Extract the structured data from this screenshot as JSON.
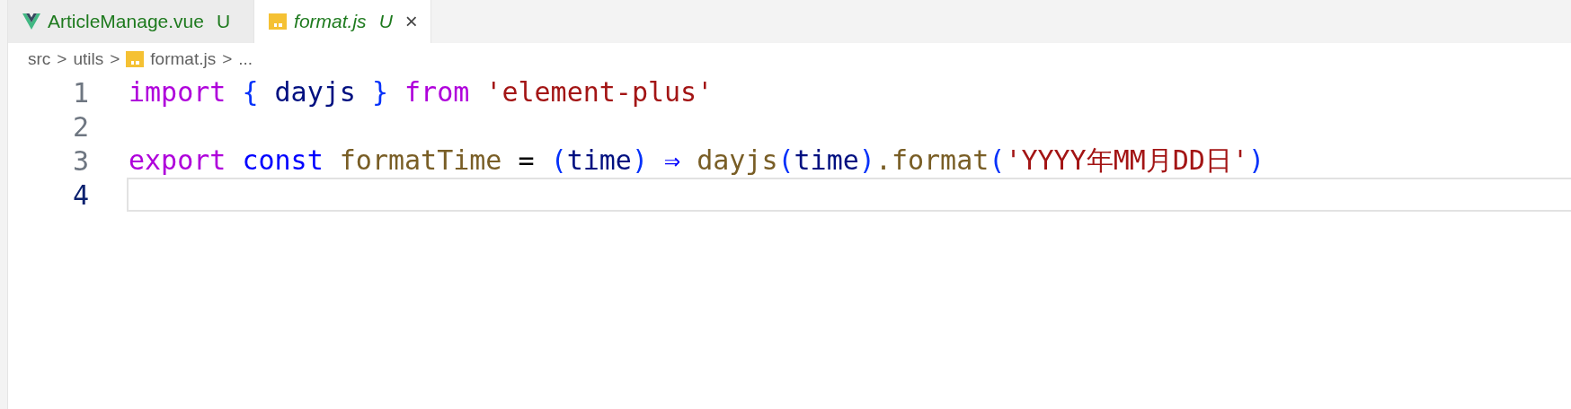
{
  "tabs": [
    {
      "label": "ArticleManage.vue",
      "badge": "U",
      "kind": "vue",
      "selected": false
    },
    {
      "label": "format.js",
      "badge": "U",
      "kind": "js",
      "selected": true,
      "close": "×"
    }
  ],
  "breadcrumb": [
    {
      "label": "src",
      "kind": "folder"
    },
    {
      "label": "utils",
      "kind": "folder"
    },
    {
      "label": "format.js",
      "kind": "js"
    },
    {
      "label": "...",
      "kind": "symbol"
    }
  ],
  "breadcrumb_separator": ">",
  "lines": [
    {
      "number": "1",
      "current": false,
      "tokens": [
        {
          "text": "import",
          "kind": "control"
        },
        {
          "text": " {",
          "kind": "bracket"
        },
        {
          "text": " dayjs ",
          "kind": "variable"
        },
        {
          "text": "}",
          "kind": "bracket"
        },
        {
          "text": " from",
          "kind": "control"
        },
        {
          "text": " 'element-plus'",
          "kind": "string"
        }
      ]
    },
    {
      "number": "2",
      "current": false
    },
    {
      "number": "3",
      "current": false,
      "tokens": [
        {
          "text": "export",
          "kind": "control"
        },
        {
          "text": " const",
          "kind": "keyword"
        },
        {
          "text": " formatTime",
          "kind": "function"
        },
        {
          "text": " = ",
          "kind": "plain"
        },
        {
          "text": "(",
          "kind": "bracket"
        },
        {
          "text": "time",
          "kind": "variable"
        },
        {
          "text": ")",
          "kind": "bracket"
        },
        {
          "text": " ⇒",
          "kind": "keyword"
        },
        {
          "text": " dayjs",
          "kind": "function"
        },
        {
          "text": "(",
          "kind": "bracket"
        },
        {
          "text": "time",
          "kind": "variable"
        },
        {
          "text": ")",
          "kind": "bracket"
        },
        {
          "text": ".format",
          "kind": "function"
        },
        {
          "text": "(",
          "kind": "bracket"
        },
        {
          "text": "'YYYY年MM月DD日'",
          "kind": "string"
        },
        {
          "text": ")",
          "kind": "bracket"
        }
      ]
    },
    {
      "number": "4",
      "current": true
    }
  ]
}
